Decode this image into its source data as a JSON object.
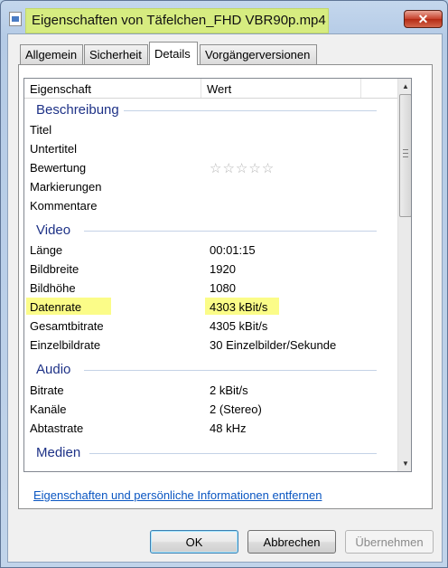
{
  "window": {
    "title": "Eigenschaften von Täfelchen_FHD VBR90p.mp4",
    "close_glyph": "✕",
    "title_highlight_color": "#d6ec80"
  },
  "tabs": [
    {
      "label": "Allgemein",
      "active": false
    },
    {
      "label": "Sicherheit",
      "active": false
    },
    {
      "label": "Details",
      "active": true
    },
    {
      "label": "Vorgängerversionen",
      "active": false
    }
  ],
  "list": {
    "header": {
      "property": "Eigenschaft",
      "value": "Wert"
    },
    "groups": [
      {
        "name": "Beschreibung",
        "rows": [
          {
            "key": "Titel",
            "value": ""
          },
          {
            "key": "Untertitel",
            "value": ""
          },
          {
            "key": "Bewertung",
            "value": "",
            "stars": "☆☆☆☆☆"
          },
          {
            "key": "Markierungen",
            "value": ""
          },
          {
            "key": "Kommentare",
            "value": ""
          }
        ]
      },
      {
        "name": "Video",
        "rows": [
          {
            "key": "Länge",
            "value": "00:01:15"
          },
          {
            "key": "Bildbreite",
            "value": "1920"
          },
          {
            "key": "Bildhöhe",
            "value": "1080"
          },
          {
            "key": "Datenrate",
            "value": "4303 kBit/s",
            "highlighted": true
          },
          {
            "key": "Gesamtbitrate",
            "value": "4305 kBit/s"
          },
          {
            "key": "Einzelbildrate",
            "value": "30 Einzelbilder/Sekunde"
          }
        ]
      },
      {
        "name": "Audio",
        "rows": [
          {
            "key": "Bitrate",
            "value": "2 kBit/s"
          },
          {
            "key": "Kanäle",
            "value": "2 (Stereo)"
          },
          {
            "key": "Abtastrate",
            "value": "48 kHz"
          }
        ]
      },
      {
        "name": "Medien",
        "rows": []
      }
    ],
    "highlight_color": "#fbfc88",
    "group_color": "#1e3287"
  },
  "link": {
    "label": "Eigenschaften und persönliche Informationen entfernen"
  },
  "buttons": {
    "ok": "OK",
    "cancel": "Abbrechen",
    "apply": "Übernehmen"
  }
}
